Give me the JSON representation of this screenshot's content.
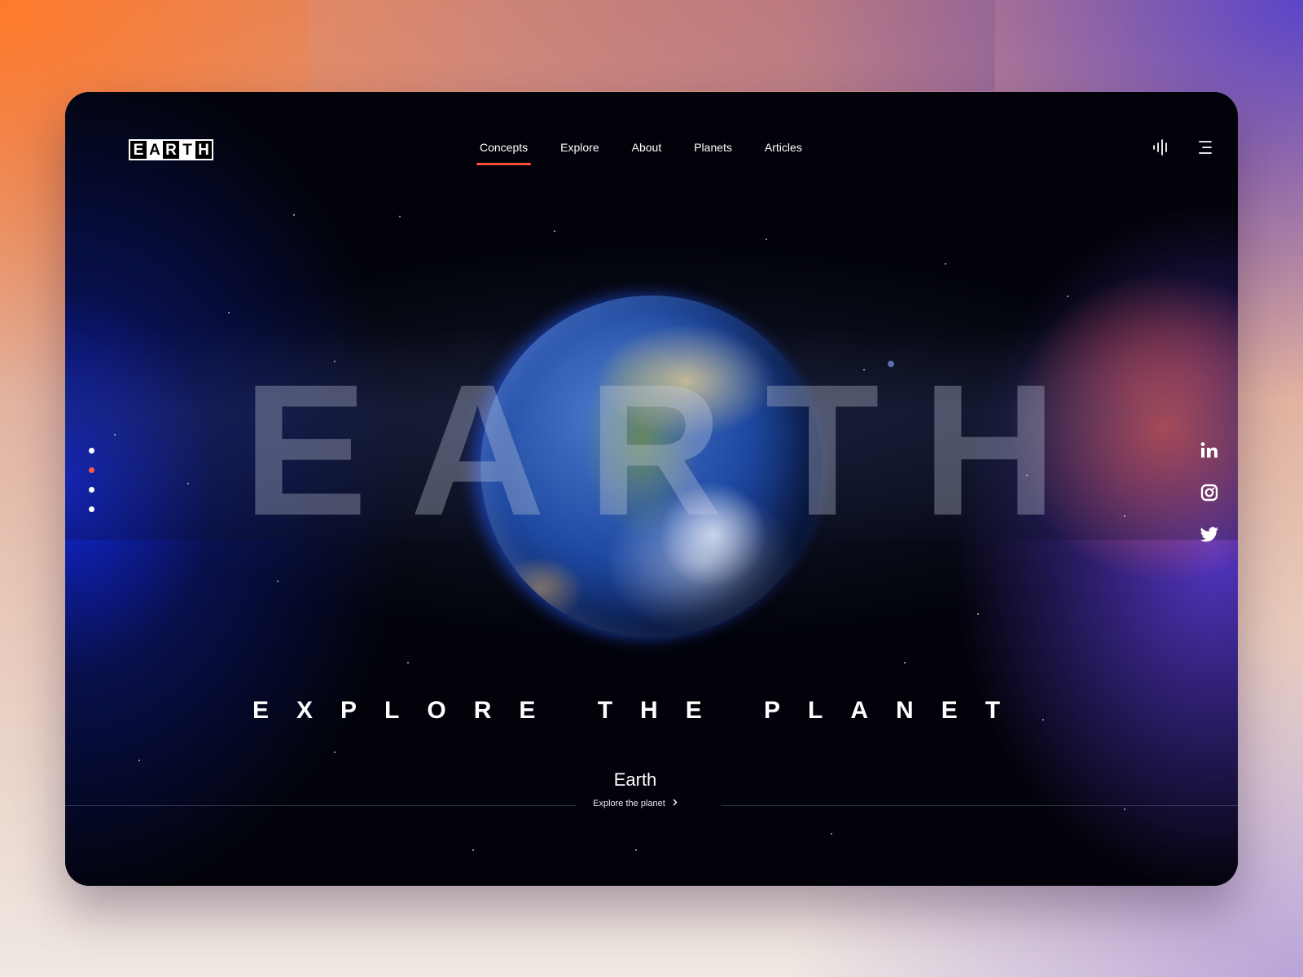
{
  "brand": {
    "letters": [
      "E",
      "A",
      "R",
      "T",
      "H"
    ]
  },
  "nav": {
    "items": [
      "Concepts",
      "Explore",
      "About",
      "Planets",
      "Articles"
    ],
    "active_index": 0
  },
  "icons": {
    "audio": "audio-wave-icon",
    "menu": "hamburger-menu-icon",
    "social": [
      "linkedin-icon",
      "instagram-icon",
      "twitter-icon"
    ]
  },
  "hero": {
    "big_letters": [
      "E",
      "A",
      "R",
      "T",
      "H"
    ],
    "tagline": "EXPLORE THE PLANET"
  },
  "slider": {
    "count": 4,
    "active_index": 1
  },
  "footer": {
    "title": "Earth",
    "link": "Explore the planet"
  },
  "colors": {
    "accent": "#ff4b3a",
    "background": "#02030a",
    "glow_blue": "#1f3cff",
    "glow_red": "#ff6050"
  }
}
